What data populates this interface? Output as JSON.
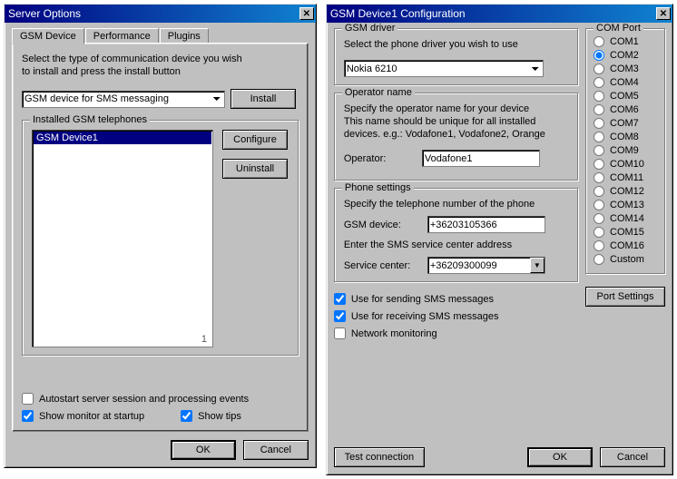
{
  "window1": {
    "title": "Server Options",
    "tabs": [
      "GSM Device",
      "Performance",
      "Plugins"
    ],
    "intro_l1": "Select the type of communication device you wish",
    "intro_l2": "to install and press the install button",
    "device_select": "GSM device for SMS messaging",
    "install_btn": "Install",
    "installed_group": "Installed GSM telephones",
    "installed_item": "GSM Device1",
    "page_indicator": "1",
    "configure_btn": "Configure",
    "uninstall_btn": "Uninstall",
    "opt_autostart": "Autostart server session and processing events",
    "opt_monitor": "Show monitor at startup",
    "opt_tips": "Show tips",
    "ok": "OK",
    "cancel": "Cancel"
  },
  "window2": {
    "title": "GSM Device1 Configuration",
    "driver_group": "GSM driver",
    "driver_text": "Select the phone driver you wish to use",
    "driver_value": "Nokia 6210",
    "operator_group": "Operator name",
    "operator_l1": "Specify the operator name for your device",
    "operator_l2": "This name should be unique for all installed",
    "operator_l3": "devices. e.g.: Vodafone1, Vodafone2, Orange",
    "operator_label": "Operator:",
    "operator_value": "Vodafone1",
    "phone_group": "Phone settings",
    "phone_l1": "Specify the telephone number of the phone",
    "gsm_label": "GSM device:",
    "gsm_value": "+36203105366",
    "phone_l2": "Enter the SMS service center address",
    "sc_label": "Service center:",
    "sc_value": "+36209300099",
    "com_group": "COM Port",
    "com_ports": [
      "COM1",
      "COM2",
      "COM3",
      "COM4",
      "COM5",
      "COM6",
      "COM7",
      "COM8",
      "COM9",
      "COM10",
      "COM11",
      "COM12",
      "COM13",
      "COM14",
      "COM15",
      "COM16",
      "Custom"
    ],
    "com_selected": "COM2",
    "port_settings": "Port Settings",
    "chk_send": "Use for sending SMS messages",
    "chk_recv": "Use for receiving SMS messages",
    "chk_net": "Network monitoring",
    "test_btn": "Test connection",
    "ok": "OK",
    "cancel": "Cancel"
  }
}
